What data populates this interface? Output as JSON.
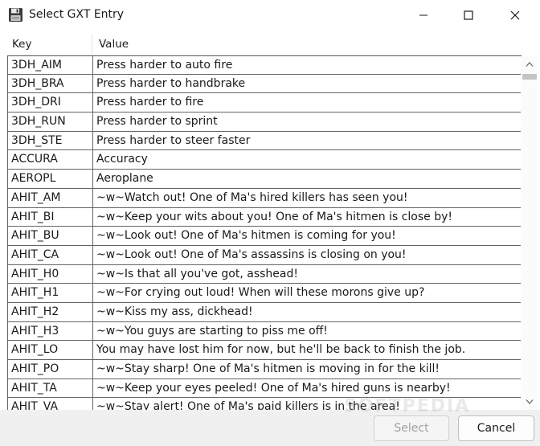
{
  "window": {
    "title": "Select GXT Entry",
    "icon": "floppy-disk-icon",
    "controls": [
      "minimize-icon",
      "maximize-icon",
      "close-icon"
    ]
  },
  "table": {
    "columns": [
      "Key",
      "Value"
    ],
    "rows": [
      {
        "key": "3DH_AIM",
        "value": "Press harder to auto fire"
      },
      {
        "key": "3DH_BRA",
        "value": "Press harder to handbrake"
      },
      {
        "key": "3DH_DRI",
        "value": "Press harder to fire"
      },
      {
        "key": "3DH_RUN",
        "value": "Press harder to sprint"
      },
      {
        "key": "3DH_STE",
        "value": "Press harder to steer faster"
      },
      {
        "key": "ACCURA",
        "value": "Accuracy"
      },
      {
        "key": "AEROPL",
        "value": "Aeroplane"
      },
      {
        "key": "AHIT_AM",
        "value": "~w~Watch out! One of Ma's hired killers has seen you!"
      },
      {
        "key": "AHIT_BI",
        "value": "~w~Keep your wits about you! One of Ma's hitmen is close by!"
      },
      {
        "key": "AHIT_BU",
        "value": "~w~Look out! One of Ma's hitmen is coming for you!"
      },
      {
        "key": "AHIT_CA",
        "value": "~w~Look out! One of Ma's assassins is closing on you!"
      },
      {
        "key": "AHIT_H0",
        "value": "~w~Is that all you've got, asshead!"
      },
      {
        "key": "AHIT_H1",
        "value": "~w~For crying out loud! When will these morons give up?"
      },
      {
        "key": "AHIT_H2",
        "value": "~w~Kiss my ass, dickhead!"
      },
      {
        "key": "AHIT_H3",
        "value": "~w~You guys are starting to piss me off!"
      },
      {
        "key": "AHIT_LO",
        "value": "You may have lost him for now, but he'll be back to finish the job."
      },
      {
        "key": "AHIT_PO",
        "value": "~w~Stay sharp! One of Ma's hitmen is moving in for the kill!"
      },
      {
        "key": "AHIT_TA",
        "value": "~w~Keep your eyes peeled! One of Ma's hired guns is nearby!"
      },
      {
        "key": "AHIT_VA",
        "value": "~w~Stay alert! One of Ma's paid killers is in the area!"
      }
    ]
  },
  "buttons": {
    "select": "Select",
    "cancel": "Cancel"
  },
  "watermark": "SOFTPEDIA"
}
